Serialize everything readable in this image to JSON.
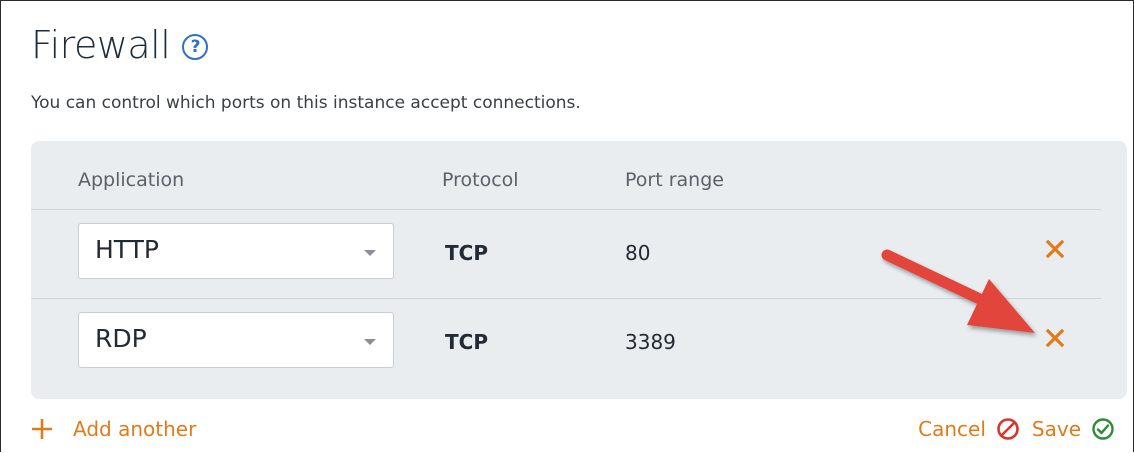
{
  "firewall": {
    "title": "Firewall",
    "help_icon": "?",
    "subtitle": "You can control which ports on this instance accept connections."
  },
  "table": {
    "headers": {
      "application": "Application",
      "protocol": "Protocol",
      "port_range": "Port range"
    },
    "rows": [
      {
        "application": "HTTP",
        "protocol": "TCP",
        "port_range": "80"
      },
      {
        "application": "RDP",
        "protocol": "TCP",
        "port_range": "3389"
      }
    ]
  },
  "actions": {
    "add_another": "Add another",
    "cancel": "Cancel",
    "save": "Save"
  },
  "icons": {
    "help": "question-circle-icon",
    "remove": "close-x-icon",
    "add": "plus-icon",
    "cancel": "no-entry-icon",
    "save": "check-circle-icon",
    "annotation": "red-arrow"
  },
  "colors": {
    "accent": "#e07b1a",
    "help": "#2d72c8",
    "arrow": "#e2443a",
    "save_check": "#2e8b3a",
    "cancel_icon": "#d9362b",
    "panel_bg": "#e9edf0"
  }
}
